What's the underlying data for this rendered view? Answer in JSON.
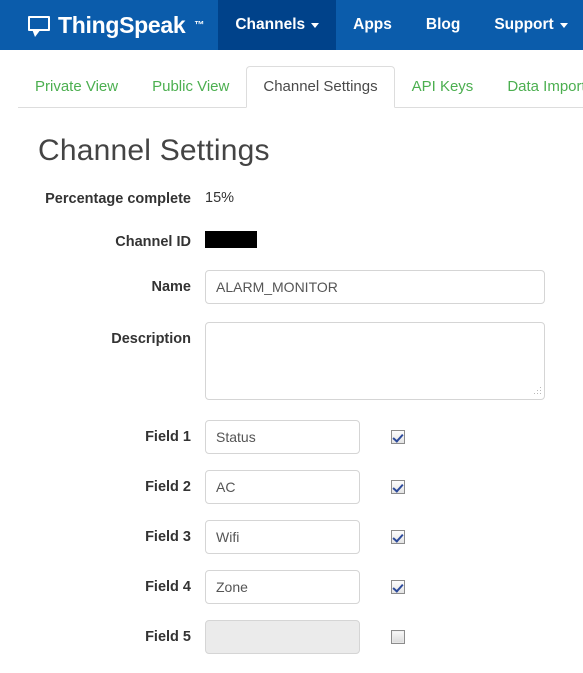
{
  "navbar": {
    "brand": {
      "name": "ThingSpeak",
      "tm": "™",
      "icon": "chat-bubble-icon"
    },
    "items": [
      {
        "label": "Channels",
        "active": true,
        "has_caret": true
      },
      {
        "label": "Apps",
        "active": false,
        "has_caret": false
      },
      {
        "label": "Blog",
        "active": false,
        "has_caret": false
      },
      {
        "label": "Support",
        "active": false,
        "has_caret": true
      }
    ],
    "bg_color": "#0b5cab",
    "active_bg_color": "#00428a"
  },
  "tabs": [
    {
      "label": "Private View",
      "active": false
    },
    {
      "label": "Public View",
      "active": false
    },
    {
      "label": "Channel Settings",
      "active": true
    },
    {
      "label": "API Keys",
      "active": false
    },
    {
      "label": "Data Import /",
      "active": false
    }
  ],
  "tab_colors": {
    "inactive": "#4caf50",
    "active": "#4a4a4a"
  },
  "page": {
    "title": "Channel Settings"
  },
  "form": {
    "percentage": {
      "label": "Percentage complete",
      "value": "15%"
    },
    "channel_id": {
      "label": "Channel ID",
      "value": "",
      "redacted": true
    },
    "name": {
      "label": "Name",
      "value": "ALARM_MONITOR",
      "placeholder": ""
    },
    "description": {
      "label": "Description",
      "value": "",
      "placeholder": ""
    },
    "fields": [
      {
        "label": "Field 1",
        "value": "Status",
        "enabled": true,
        "checked": true
      },
      {
        "label": "Field 2",
        "value": "AC",
        "enabled": true,
        "checked": true
      },
      {
        "label": "Field 3",
        "value": "Wifi",
        "enabled": true,
        "checked": true
      },
      {
        "label": "Field 4",
        "value": "Zone",
        "enabled": true,
        "checked": true
      },
      {
        "label": "Field 5",
        "value": "",
        "enabled": false,
        "checked": false
      }
    ]
  }
}
